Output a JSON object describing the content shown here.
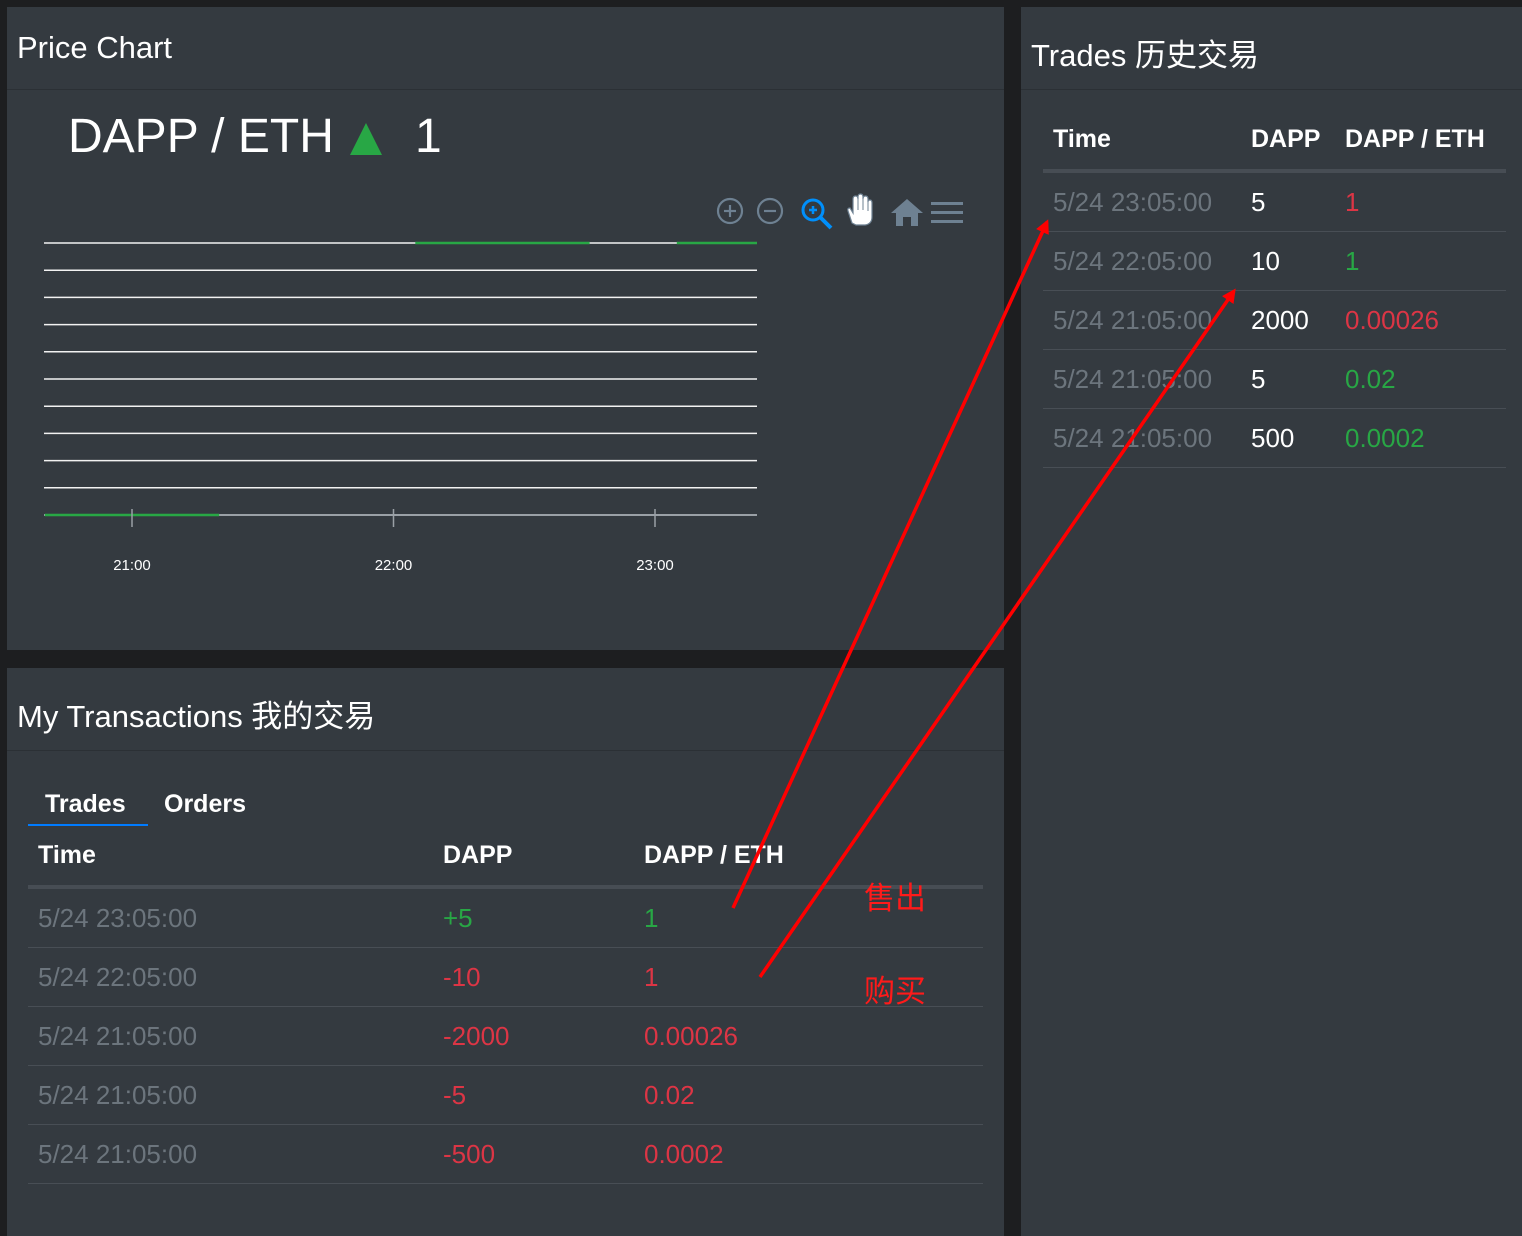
{
  "price_chart": {
    "title": "Price Chart",
    "pair": "DAPP / ETH",
    "price": "1",
    "trend_icon": "triangle-up-icon",
    "toolbar": {
      "zoom_in_icon": "zoom-in-icon",
      "zoom_out_icon": "zoom-out-icon",
      "selection_zoom_icon": "selection-zoom-icon",
      "pan_icon": "pan-hand-icon",
      "reset_icon": "home-icon",
      "menu_icon": "menu-icon"
    },
    "active_tool_color": "#008ffb",
    "up_color": "#28a745"
  },
  "chart_data": {
    "type": "line",
    "x_ticks": [
      "21:00",
      "22:00",
      "23:00"
    ],
    "y_ticks": [],
    "grid": true,
    "series": [
      {
        "values": [
          {
            "x": "20:40",
            "y": 0
          },
          {
            "x": "21:20",
            "y": 0
          },
          {
            "x": "22:05",
            "y": 1
          },
          {
            "x": "22:45",
            "y": 1
          },
          {
            "x": "23:05",
            "y": 1
          },
          {
            "x": "23:45",
            "y": 1
          }
        ]
      }
    ]
  },
  "trades": {
    "title": "Trades 历史交易",
    "headers": [
      "Time",
      "DAPP",
      "DAPP / ETH"
    ],
    "rows": [
      {
        "time": "5/24 23:05:00",
        "amount": "5",
        "price": "1",
        "price_color": "red"
      },
      {
        "time": "5/24 22:05:00",
        "amount": "10",
        "price": "1",
        "price_color": "green"
      },
      {
        "time": "5/24 21:05:00",
        "amount": "2000",
        "price": "0.00026",
        "price_color": "red"
      },
      {
        "time": "5/24 21:05:00",
        "amount": "5",
        "price": "0.02",
        "price_color": "green"
      },
      {
        "time": "5/24 21:05:00",
        "amount": "500",
        "price": "0.0002",
        "price_color": "green"
      }
    ]
  },
  "my_transactions": {
    "title": "My Transactions 我的交易",
    "tabs": [
      "Trades",
      "Orders"
    ],
    "active_tab": "Trades",
    "headers": [
      "Time",
      "DAPP",
      "DAPP / ETH"
    ],
    "rows": [
      {
        "time": "5/24 23:05:00",
        "amount": "+5",
        "price": "1",
        "color": "green"
      },
      {
        "time": "5/24 22:05:00",
        "amount": "-10",
        "price": "1",
        "color": "red"
      },
      {
        "time": "5/24 21:05:00",
        "amount": "-2000",
        "price": "0.00026",
        "color": "red"
      },
      {
        "time": "5/24 21:05:00",
        "amount": "-5",
        "price": "0.02",
        "color": "red"
      },
      {
        "time": "5/24 21:05:00",
        "amount": "-500",
        "price": "0.0002",
        "color": "red"
      }
    ]
  },
  "annotations": {
    "sell_label": "售出",
    "buy_label": "购买",
    "arrow_color": "#ff0000"
  }
}
